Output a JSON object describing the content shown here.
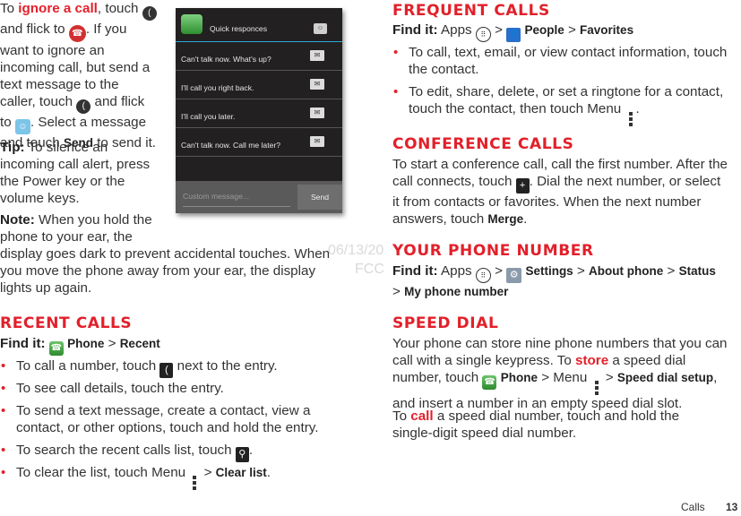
{
  "intro": {
    "line1_pre": "To ",
    "ignore_link": "ignore a call",
    "line1_post": ", touch",
    "line2_pre": "and flick to",
    "line2_post": ". If you",
    "line3": "want to ignore an",
    "line4": "incoming call, but send a",
    "line5": "text message to the",
    "line6_pre": "caller, touch",
    "line6_post": "and flick",
    "line7_pre": "to",
    "line7_post": ". Select a message",
    "line8_pre": "and touch ",
    "line8_bold": "Send",
    "line8_post": " to send it."
  },
  "tip": {
    "label": "Tip:",
    "line1": " To silence an",
    "line2": "incoming call alert, press",
    "line3": "the Power key or the",
    "line4": "volume keys."
  },
  "note": {
    "label": "Note:",
    "line1": " When you hold the",
    "line2": "phone to your ear, the",
    "line3": "display goes dark to prevent accidental touches. When",
    "line4": "you move the phone away from your ear, the display",
    "line5": "lights up again."
  },
  "phone_screen": {
    "title": "Quick responces",
    "responses": [
      "Can't talk now. What's up?",
      "I'll call you right back.",
      "I'll call you later.",
      "Can't talk now. Call me later?"
    ],
    "custom_placeholder": "Custom message...",
    "send_label": "Send"
  },
  "recent_calls": {
    "heading": "RECENT CALLS",
    "find_label": "Find it:",
    "path_app": "Phone",
    "path_sep": ">",
    "path_item": "Recent",
    "bullets": {
      "b1_pre": "To call a number, touch",
      "b1_post": "next to the entry.",
      "b2": "To see call details, touch the entry.",
      "b3_l1": "To send a text message, create a contact, view a",
      "b3_l2": "contact, or other options, touch and hold the entry.",
      "b4_pre": "To search the recent calls list, touch",
      "b4_post": ".",
      "b5_pre": "To clear the list, touch Menu",
      "b5_sep": ">",
      "b5_bold": "Clear list",
      "b5_post": "."
    }
  },
  "frequent_calls": {
    "heading": "FREQUENT CALLS",
    "find_label": "Find it:",
    "apps": "Apps",
    "sep": ">",
    "app": "People",
    "item": "Favorites",
    "b1_l1": "To call, text, email, or view contact information, touch",
    "b1_l2": "the contact.",
    "b2_l1": "To edit, share, delete, or set a ringtone for a contact,",
    "b2_l2_pre": "touch the contact, then touch Menu",
    "b2_l2_post": "."
  },
  "conference_calls": {
    "heading": "CONFERENCE CALLS",
    "l1": "To start a conference call, call the first number. After the",
    "l2_pre": "call connects, touch",
    "l2_post": ". Dial the next number, or select",
    "l3": "it from contacts or favorites. When the next number",
    "l4_pre": "answers, touch ",
    "l4_bold": "Merge",
    "l4_post": "."
  },
  "your_phone_number": {
    "heading": "YOUR PHONE NUMBER",
    "find_label": "Find it:",
    "apps": "Apps",
    "sep": ">",
    "settings": "Settings",
    "about": "About phone",
    "status": "Status",
    "my_number": "My phone number"
  },
  "speed_dial": {
    "heading": "SPEED DIAL",
    "l1": "Your phone can store nine phone numbers that you can",
    "l2_pre": "call with a single keypress. To ",
    "l2_red": "store",
    "l2_post": " a speed dial",
    "l3_pre": "number, touch",
    "l3_app": "Phone",
    "l3_mid": "> Menu",
    "l3_sep": ">",
    "l3_bold": "Speed dial setup",
    "l3_post": ",",
    "l4": "and insert a number in an empty speed dial slot.",
    "p2_pre": "To ",
    "p2_red": "call",
    "p2_post": " a speed dial number, touch and hold the",
    "p2_l2": "single-digit speed dial number."
  },
  "watermark": {
    "date": "06/13/20",
    "fcc": "FCC"
  },
  "footer": {
    "section": "Calls",
    "page": "13"
  }
}
